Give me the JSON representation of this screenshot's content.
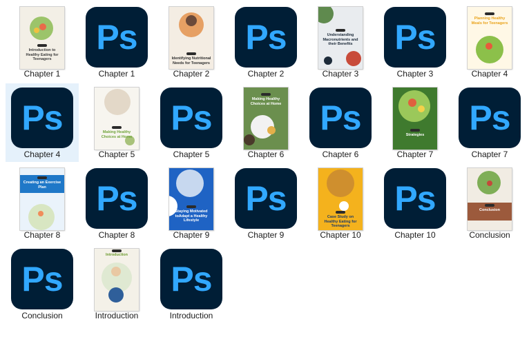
{
  "items": [
    {
      "label": "Chapter 1",
      "kind": "cover",
      "style": "c1",
      "cover_title": "Introduction to Healthy Eating for Teenagers"
    },
    {
      "label": "Chapter 1",
      "kind": "ps",
      "icon_text": "Ps"
    },
    {
      "label": "Chapter 2",
      "kind": "cover",
      "style": "c2",
      "cover_title": "Identifying Nutritional Needs for Teenagers"
    },
    {
      "label": "Chapter 2",
      "kind": "ps",
      "icon_text": "Ps"
    },
    {
      "label": "Chapter 3",
      "kind": "cover",
      "style": "c3",
      "cover_title": "Understanding Macronutrients and their Benefits"
    },
    {
      "label": "Chapter 3",
      "kind": "ps",
      "icon_text": "Ps"
    },
    {
      "label": "Chapter 4",
      "kind": "cover",
      "style": "c4",
      "cover_title": "Planning Healthy Meals for Teenagers"
    },
    {
      "label": "Chapter 4",
      "kind": "ps",
      "icon_text": "Ps",
      "selected": true
    },
    {
      "label": "Chapter 5",
      "kind": "cover",
      "style": "c5",
      "cover_title": "Making Healthy Choices at Home"
    },
    {
      "label": "Chapter 5",
      "kind": "ps",
      "icon_text": "Ps"
    },
    {
      "label": "Chapter 6",
      "kind": "cover",
      "style": "c6",
      "cover_title": "Making Healthy Choices at Home"
    },
    {
      "label": "Chapter 6",
      "kind": "ps",
      "icon_text": "Ps"
    },
    {
      "label": "Chapter 7",
      "kind": "cover",
      "style": "c7",
      "cover_title": "Strategies"
    },
    {
      "label": "Chapter 7",
      "kind": "ps",
      "icon_text": "Ps"
    },
    {
      "label": "Chapter 8",
      "kind": "cover",
      "style": "c8",
      "cover_title": "Creating an Exercise Plan"
    },
    {
      "label": "Chapter 8",
      "kind": "ps",
      "icon_text": "Ps"
    },
    {
      "label": "Chapter 9",
      "kind": "cover",
      "style": "c9",
      "cover_title": "Staying Motivated toAdapt a Healthy Lifestyle"
    },
    {
      "label": "Chapter 9",
      "kind": "ps",
      "icon_text": "Ps"
    },
    {
      "label": "Chapter 10",
      "kind": "cover",
      "style": "c10",
      "cover_title": "Case Study on Healthy Eating for Teenagers"
    },
    {
      "label": "Chapter 10",
      "kind": "ps",
      "icon_text": "Ps"
    },
    {
      "label": "Conclusion",
      "kind": "cover",
      "style": "c11",
      "cover_title": "Conclusion"
    },
    {
      "label": "Conclusion",
      "kind": "ps",
      "icon_text": "Ps"
    },
    {
      "label": "Introduction",
      "kind": "cover",
      "style": "c12",
      "cover_title": "Introduction"
    },
    {
      "label": "Introduction",
      "kind": "ps",
      "icon_text": "Ps"
    }
  ],
  "colors": {
    "ps_bg": "#001e36",
    "ps_text": "#31a8ff",
    "selection": "#e5f1fb"
  }
}
